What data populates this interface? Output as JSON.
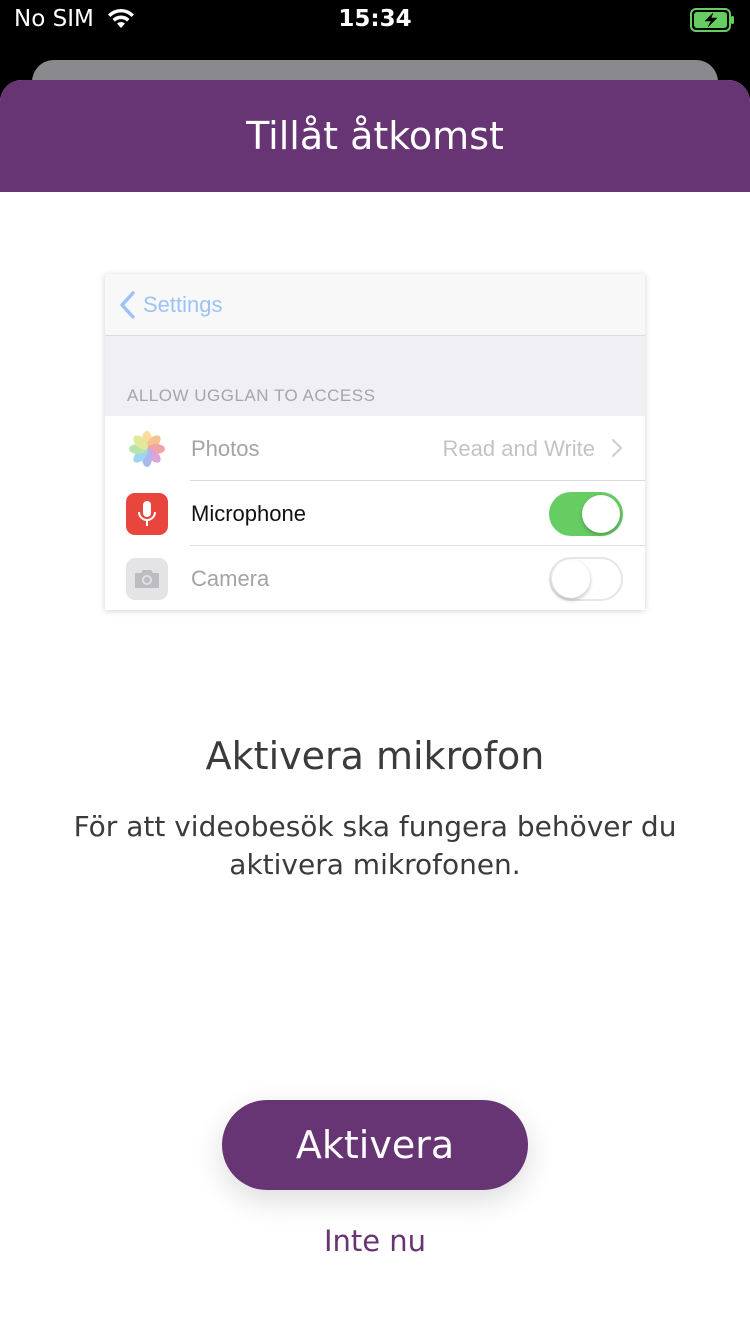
{
  "status_bar": {
    "carrier": "No SIM",
    "time": "15:34"
  },
  "modal": {
    "title": "Tillåt åtkomst"
  },
  "illustration": {
    "back_label": "Settings",
    "section_header": "ALLOW UGGLAN TO ACCESS",
    "rows": [
      {
        "label": "Photos",
        "value": "Read and Write"
      },
      {
        "label": "Microphone",
        "toggle": "on"
      },
      {
        "label": "Camera",
        "toggle": "off"
      }
    ]
  },
  "content": {
    "heading": "Aktivera mikrofon",
    "description": "För att videobesök ska fungera behöver du aktivera mikrofonen."
  },
  "actions": {
    "primary": "Aktivera",
    "secondary": "Inte nu"
  },
  "colors": {
    "brand": "#673474",
    "toggle_on": "#66cd63",
    "mic_icon": "#e8453c"
  }
}
